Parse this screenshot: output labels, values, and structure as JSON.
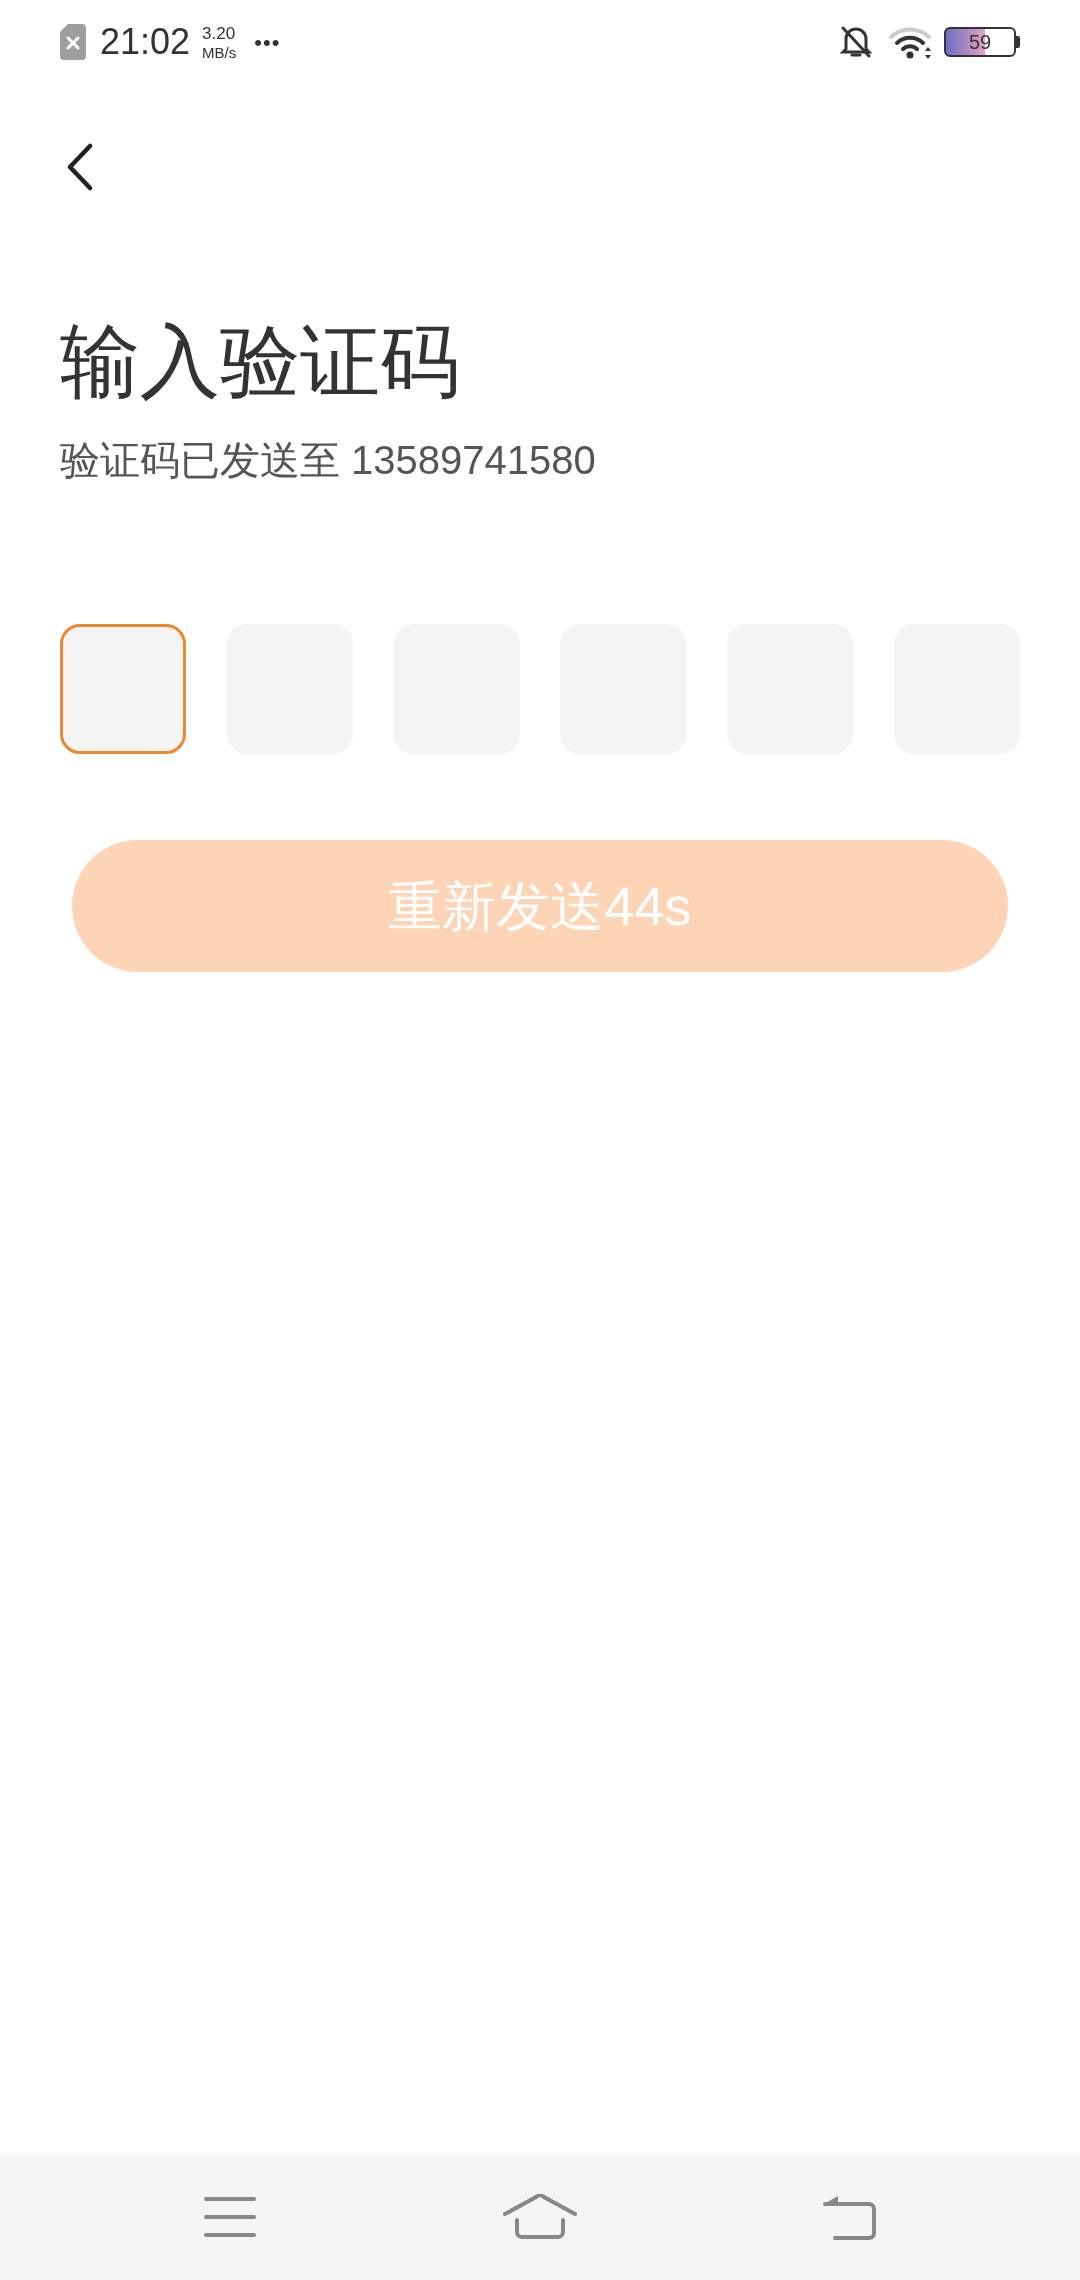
{
  "status_bar": {
    "time": "21:02",
    "speed": "3.20",
    "speed_unit": "MB/s",
    "more": "•••",
    "battery": "59"
  },
  "title": "输入验证码",
  "subtitle": "验证码已发送至 13589741580",
  "code_boxes": [
    {
      "selected": true
    },
    {
      "selected": false
    },
    {
      "selected": false
    },
    {
      "selected": false
    },
    {
      "selected": false
    },
    {
      "selected": false
    }
  ],
  "resend_button": {
    "label": "重新发送44s",
    "disabled": true
  }
}
